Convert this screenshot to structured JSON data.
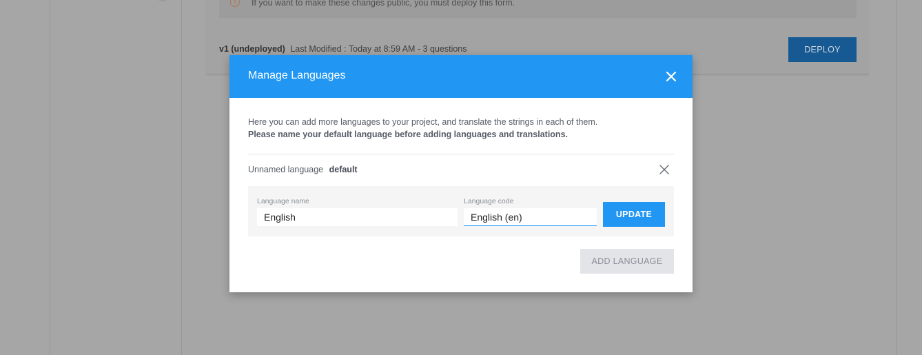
{
  "background": {
    "warning_icon": "!",
    "warning_text": "If you want to make these changes public, you must deploy this form.",
    "version_label": "v1 (undeployed)",
    "last_modified": "Last Modified : Today at 8:59 AM - 3 questions",
    "deploy_label": "DEPLOY"
  },
  "modal": {
    "title": "Manage Languages",
    "intro_line_1": "Here you can add more languages to your project, and translate the strings in each of them.",
    "intro_line_2": "Please name your default language before adding languages and translations.",
    "language_row": {
      "name": "Unnamed language",
      "tag": "default"
    },
    "form": {
      "language_name_label": "Language name",
      "language_name_value": "English",
      "language_code_label": "Language code",
      "language_code_value": "English (en)",
      "update_label": "UPDATE"
    },
    "add_language_label": "ADD LANGUAGE"
  },
  "colors": {
    "accent": "#2196f3",
    "overlay": "#a6a6a6",
    "disabled_button": "#e3e4e8"
  },
  "icons": {
    "modal_close": "close-icon",
    "row_remove": "close-icon",
    "warning": "warning-icon"
  }
}
